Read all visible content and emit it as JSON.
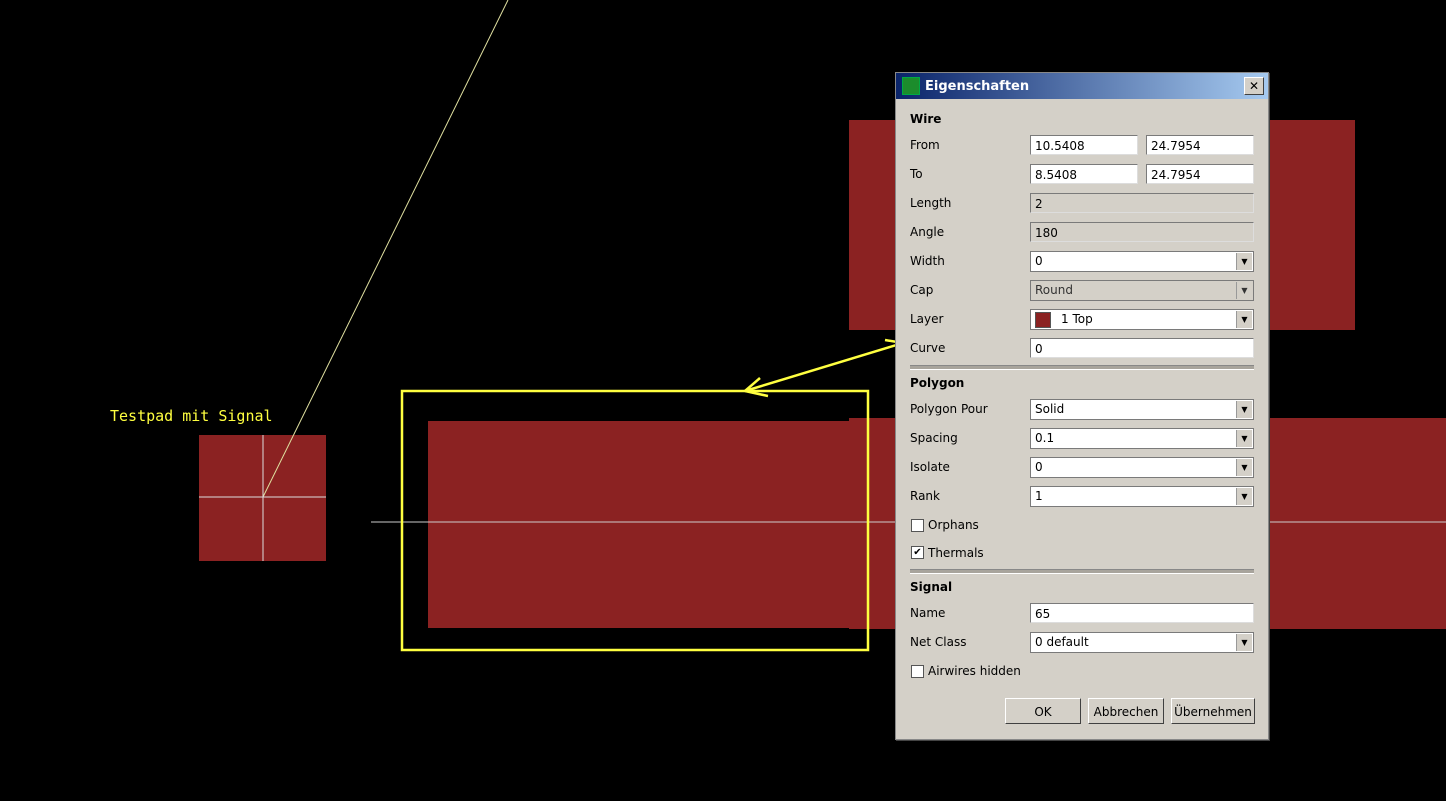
{
  "canvas": {
    "label": "Testpad mit Signal",
    "pad_color": "#8b2222",
    "highlight_color": "#ffff40"
  },
  "dialog": {
    "title": "Eigenschaften",
    "wire": {
      "heading": "Wire",
      "from_label": "From",
      "from_x": "10.5408",
      "from_y": "24.7954",
      "to_label": "To",
      "to_x": "8.5408",
      "to_y": "24.7954",
      "length_label": "Length",
      "length": "2",
      "angle_label": "Angle",
      "angle": "180",
      "width_label": "Width",
      "width": "0",
      "cap_label": "Cap",
      "cap": "Round",
      "layer_label": "Layer",
      "layer": "1 Top",
      "curve_label": "Curve",
      "curve": "0"
    },
    "polygon": {
      "heading": "Polygon",
      "pour_label": "Polygon Pour",
      "pour": "Solid",
      "spacing_label": "Spacing",
      "spacing": "0.1",
      "isolate_label": "Isolate",
      "isolate": "0",
      "rank_label": "Rank",
      "rank": "1",
      "orphans_label": "Orphans",
      "orphans_checked": false,
      "thermals_label": "Thermals",
      "thermals_checked": true
    },
    "signal": {
      "heading": "Signal",
      "name_label": "Name",
      "name": "65",
      "netclass_label": "Net Class",
      "netclass": "0 default",
      "airwires_label": "Airwires hidden",
      "airwires_checked": false
    },
    "buttons": {
      "ok": "OK",
      "cancel": "Abbrechen",
      "apply": "Übernehmen"
    },
    "check_mark": "✔"
  }
}
